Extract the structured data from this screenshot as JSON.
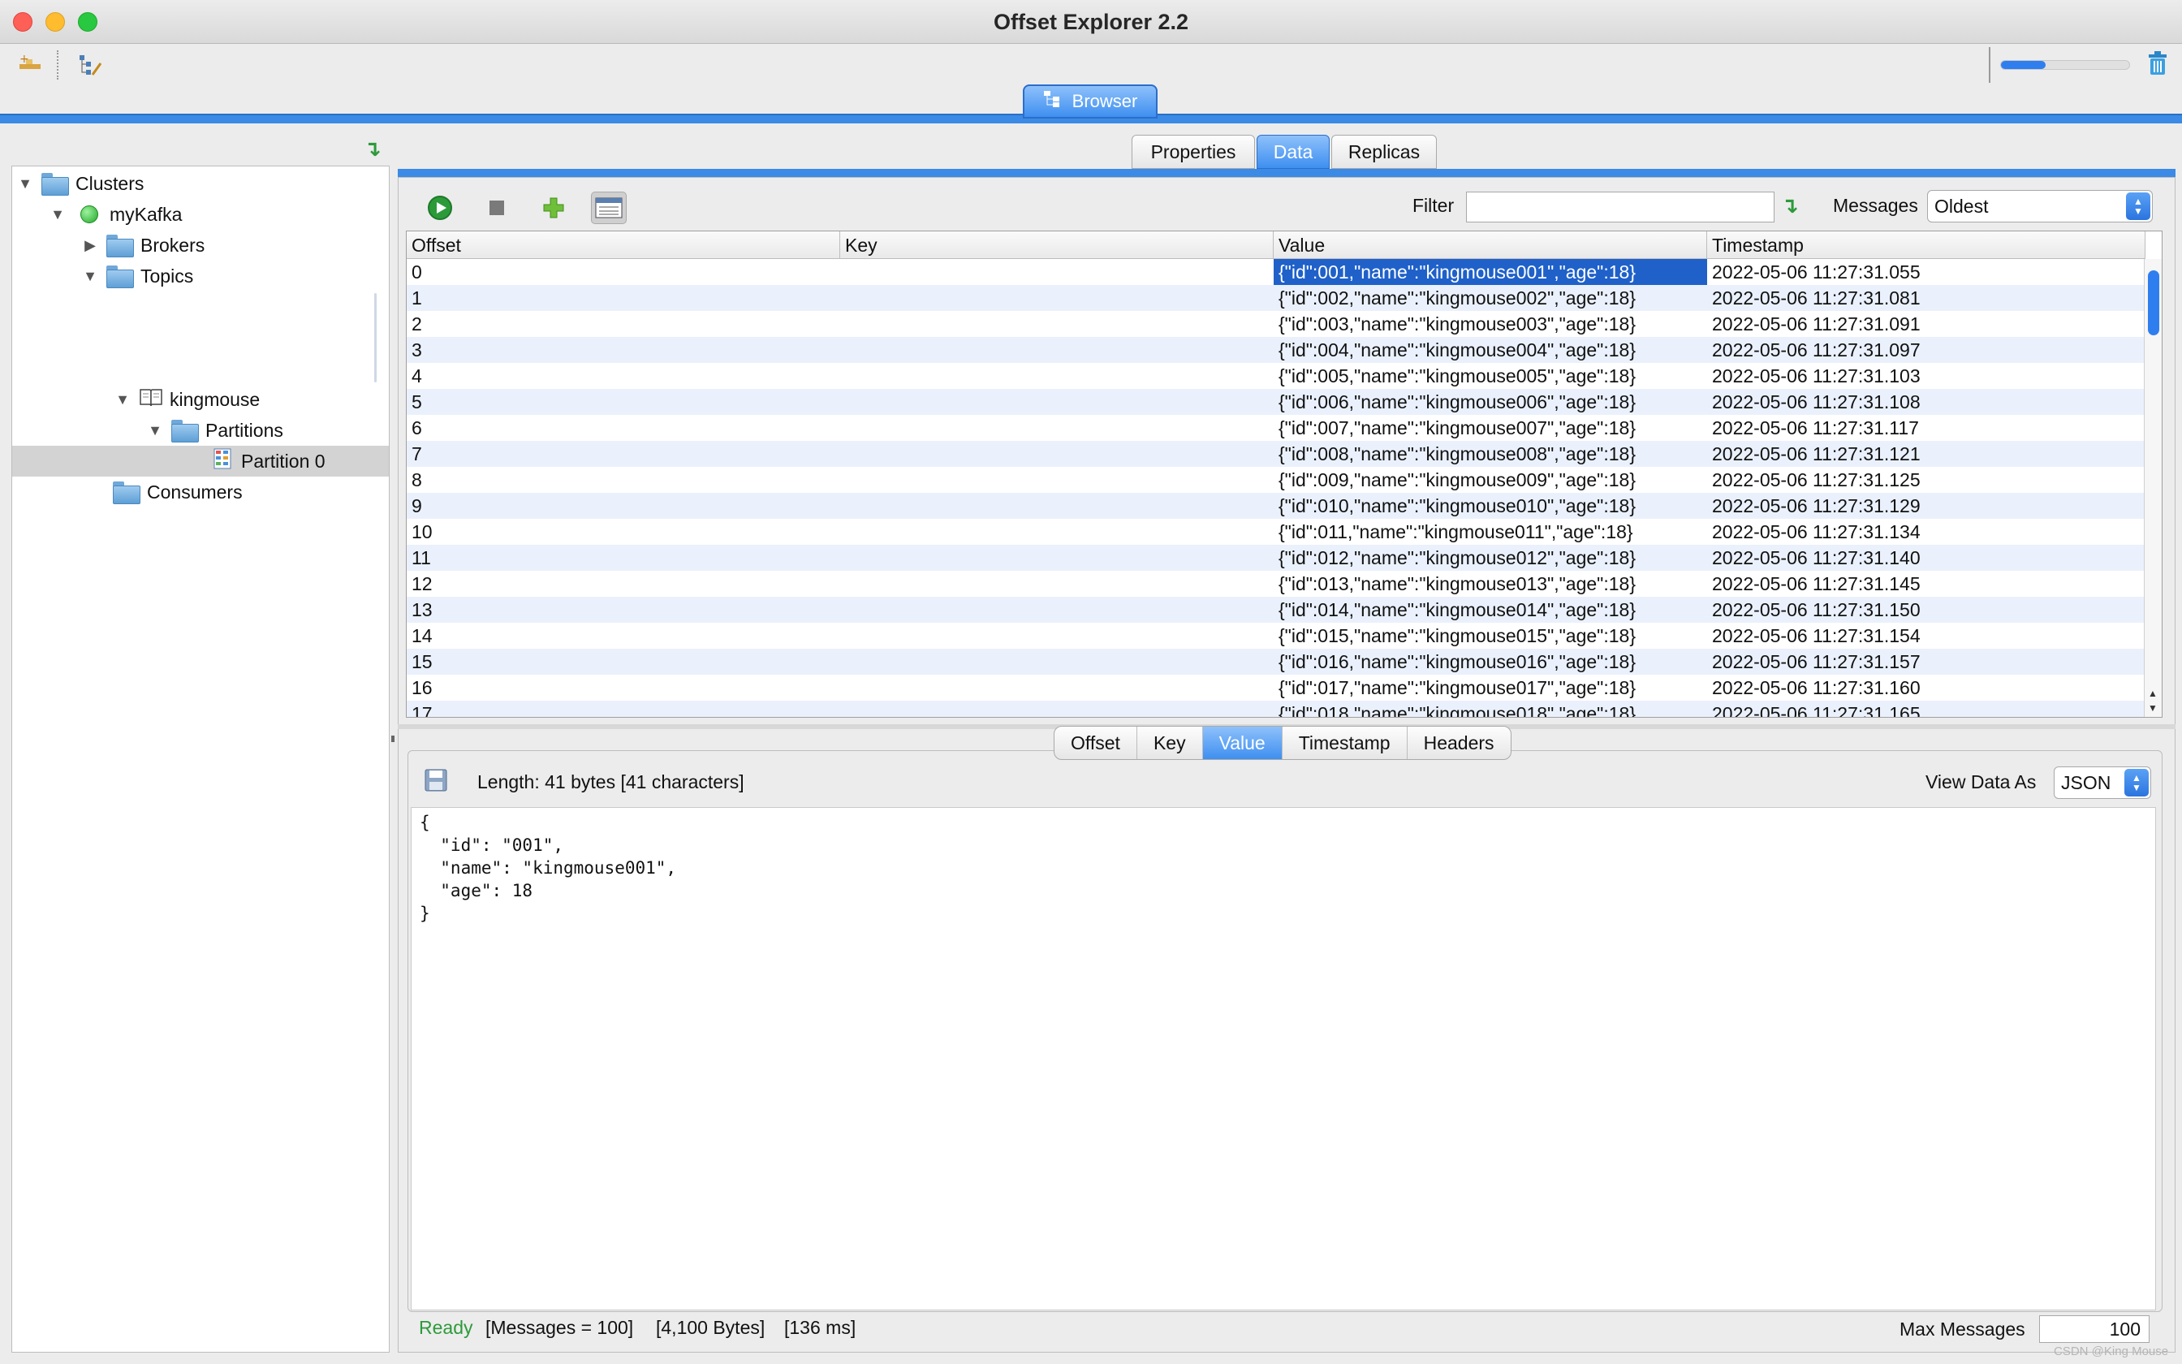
{
  "window": {
    "title": "Offset Explorer  2.2"
  },
  "toolbar": {
    "progress_fraction": 0.35
  },
  "browser_tab": {
    "label": "Browser"
  },
  "tree": {
    "items": [
      {
        "label": "Clusters"
      },
      {
        "label": "myKafka"
      },
      {
        "label": "Brokers"
      },
      {
        "label": "Topics"
      },
      {
        "label": "kingmouse"
      },
      {
        "label": "Partitions"
      },
      {
        "label": "Partition 0"
      },
      {
        "label": "Consumers"
      }
    ]
  },
  "detail_tabs": [
    "Properties",
    "Data",
    "Replicas"
  ],
  "data_toolbar": {
    "filter_label": "Filter",
    "filter_value": "",
    "messages_label": "Messages",
    "messages_value": "Oldest"
  },
  "table": {
    "columns": [
      "Offset",
      "Key",
      "Value",
      "Timestamp"
    ],
    "rows": [
      [
        "0",
        "",
        "{\"id\":001,\"name\":\"kingmouse001\",\"age\":18}",
        "2022-05-06 11:27:31.055"
      ],
      [
        "1",
        "",
        "{\"id\":002,\"name\":\"kingmouse002\",\"age\":18}",
        "2022-05-06 11:27:31.081"
      ],
      [
        "2",
        "",
        "{\"id\":003,\"name\":\"kingmouse003\",\"age\":18}",
        "2022-05-06 11:27:31.091"
      ],
      [
        "3",
        "",
        "{\"id\":004,\"name\":\"kingmouse004\",\"age\":18}",
        "2022-05-06 11:27:31.097"
      ],
      [
        "4",
        "",
        "{\"id\":005,\"name\":\"kingmouse005\",\"age\":18}",
        "2022-05-06 11:27:31.103"
      ],
      [
        "5",
        "",
        "{\"id\":006,\"name\":\"kingmouse006\",\"age\":18}",
        "2022-05-06 11:27:31.108"
      ],
      [
        "6",
        "",
        "{\"id\":007,\"name\":\"kingmouse007\",\"age\":18}",
        "2022-05-06 11:27:31.117"
      ],
      [
        "7",
        "",
        "{\"id\":008,\"name\":\"kingmouse008\",\"age\":18}",
        "2022-05-06 11:27:31.121"
      ],
      [
        "8",
        "",
        "{\"id\":009,\"name\":\"kingmouse009\",\"age\":18}",
        "2022-05-06 11:27:31.125"
      ],
      [
        "9",
        "",
        "{\"id\":010,\"name\":\"kingmouse010\",\"age\":18}",
        "2022-05-06 11:27:31.129"
      ],
      [
        "10",
        "",
        "{\"id\":011,\"name\":\"kingmouse011\",\"age\":18}",
        "2022-05-06 11:27:31.134"
      ],
      [
        "11",
        "",
        "{\"id\":012,\"name\":\"kingmouse012\",\"age\":18}",
        "2022-05-06 11:27:31.140"
      ],
      [
        "12",
        "",
        "{\"id\":013,\"name\":\"kingmouse013\",\"age\":18}",
        "2022-05-06 11:27:31.145"
      ],
      [
        "13",
        "",
        "{\"id\":014,\"name\":\"kingmouse014\",\"age\":18}",
        "2022-05-06 11:27:31.150"
      ],
      [
        "14",
        "",
        "{\"id\":015,\"name\":\"kingmouse015\",\"age\":18}",
        "2022-05-06 11:27:31.154"
      ],
      [
        "15",
        "",
        "{\"id\":016,\"name\":\"kingmouse016\",\"age\":18}",
        "2022-05-06 11:27:31.157"
      ],
      [
        "16",
        "",
        "{\"id\":017,\"name\":\"kingmouse017\",\"age\":18}",
        "2022-05-06 11:27:31.160"
      ],
      [
        "17",
        "",
        "{\"id\":018,\"name\":\"kingmouse018\",\"age\":18}",
        "2022-05-06 11:27:31.165"
      ]
    ]
  },
  "bottom_tabs": [
    "Offset",
    "Key",
    "Value",
    "Timestamp",
    "Headers"
  ],
  "viewer": {
    "length_text": "Length: 41 bytes [41 characters]",
    "view_as_label": "View Data As",
    "view_as_value": "JSON",
    "content": "{\n  \"id\": \"001\",\n  \"name\": \"kingmouse001\",\n  \"age\": 18\n}"
  },
  "status": {
    "ready": "Ready",
    "messages": "[Messages = 100]",
    "bytes": "[4,100 Bytes]",
    "ms": "[136 ms]",
    "max_messages_label": "Max Messages",
    "max_messages_value": "100"
  },
  "watermark": "CSDN @King Mouse",
  "colors": {
    "accent": "#3e8ff0",
    "selection": "#1f61c9",
    "ready": "#2d9a3a"
  }
}
